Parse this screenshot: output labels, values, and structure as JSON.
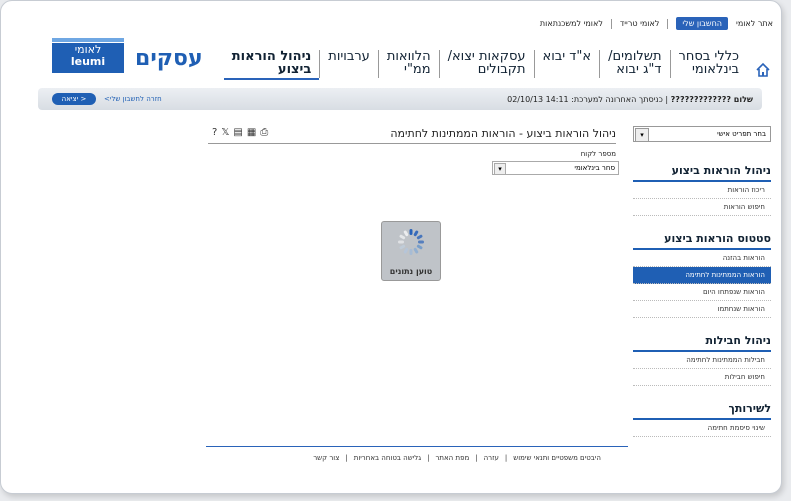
{
  "top_links": [
    {
      "label": "אתר לאומי",
      "active": false
    },
    {
      "label": "החשבון שלי",
      "active": true
    },
    {
      "label": "לאומי טרייד",
      "active": false
    },
    {
      "label": "לאומי למשכנתאות",
      "active": false
    }
  ],
  "main_nav": [
    {
      "label": "כללי בסחר\nבינלאומי",
      "active": false
    },
    {
      "label": "תשלומים/\nד\"ג יבוא",
      "active": false
    },
    {
      "label": "א\"ד יבוא",
      "active": false
    },
    {
      "label": "עסקאות יצוא/\nתקבולים",
      "active": false
    },
    {
      "label": "הלוואות\nממ\"י",
      "active": false
    },
    {
      "label": "ערבויות",
      "active": false
    },
    {
      "label": "ניהול הוראות\nביצוע",
      "active": true
    }
  ],
  "brand": {
    "name": "עסקים",
    "logo_heb": "לאומי",
    "logo_eng": "leumi"
  },
  "status_bar": {
    "greeting": "שלום ?????????????",
    "last_login": "| כניסתך האחרונה למערכת: 14:11 02/10/13",
    "back_link": "<חזרה לחשבון שלי",
    "exit_button": "יציאה >"
  },
  "sidebar": {
    "select_placeholder": "בחר תפריט אישי",
    "sections": [
      {
        "title": "ניהול הוראות ביצוע",
        "items": [
          {
            "label": "ריכוז הוראות",
            "active": false
          },
          {
            "label": "חיפוש הוראות",
            "active": false
          }
        ]
      },
      {
        "title": "סטטוס הוראות ביצוע",
        "items": [
          {
            "label": "הוראות בהזנה",
            "active": false
          },
          {
            "label": "הוראות הממתינות לחתימה",
            "active": true
          },
          {
            "label": "הוראות שנפתחו היום",
            "active": false
          },
          {
            "label": "הוראות שנחתמו",
            "active": false
          }
        ]
      },
      {
        "title": "ניהול חבילות",
        "items": [
          {
            "label": "חבילות הממתינות לחתימה",
            "active": false
          },
          {
            "label": "חיפוש חבילות",
            "active": false
          }
        ]
      },
      {
        "title": "לשירותך",
        "items": [
          {
            "label": "שינוי סיסמת חתימה",
            "active": false
          }
        ]
      }
    ]
  },
  "content": {
    "title": "ניהול הוראות ביצוע - הוראות הממתינות לחתימה",
    "customer_label": "מספר לקוח",
    "customer_select": "סחר בינלאומי",
    "loading_text": "טוען נתונים"
  },
  "footer_links": [
    "היבטים משפטיים ותנאי שימוש",
    "עזרה",
    "מפת האתר",
    "גלישה בטוחה באחריות",
    "צור קשר"
  ],
  "colors": {
    "brand_blue": "#1f5fb4",
    "active_tab": "#2a63b9"
  }
}
